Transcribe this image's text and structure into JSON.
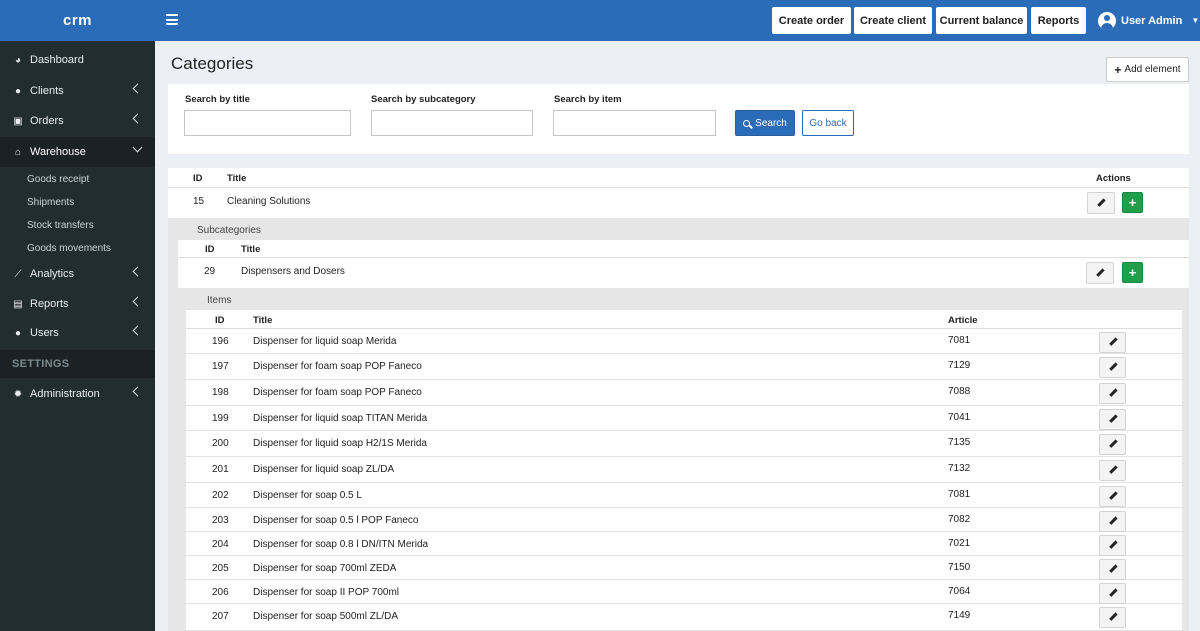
{
  "header": {
    "brand": "crm",
    "buttons": [
      "Create order",
      "Create client",
      "Current balance",
      "Reports"
    ],
    "user": "User Admin"
  },
  "sidebar": {
    "items": [
      {
        "label": "Dashboard",
        "icon": "dashboard-icon"
      },
      {
        "label": "Clients",
        "icon": "users-icon"
      },
      {
        "label": "Orders",
        "icon": "box-icon"
      },
      {
        "label": "Warehouse",
        "icon": "home-icon"
      },
      {
        "label": "Analytics",
        "icon": "chart-line-icon"
      },
      {
        "label": "Reports",
        "icon": "file-icon"
      },
      {
        "label": "Users",
        "icon": "users-icon"
      },
      {
        "label": "Administration",
        "icon": "gear-icon"
      }
    ],
    "warehouse_sub": [
      "Goods receipt",
      "Shipments",
      "Stock transfers",
      "Goods movements"
    ],
    "settings_label": "SETTINGS"
  },
  "page": {
    "title": "Categories",
    "add_label": "Add element"
  },
  "filters": {
    "title_label": "Search by title",
    "subcategory_label": "Search by subcategory",
    "item_label": "Search by item",
    "title_value": "",
    "subcategory_value": "",
    "item_value": "",
    "search_label": "Search",
    "goback_label": "Go back"
  },
  "category_table": {
    "headers": {
      "id": "ID",
      "title": "Title",
      "actions": "Actions"
    },
    "row": {
      "id": "15",
      "title": "Cleaning Solutions"
    }
  },
  "subcategories": {
    "label": "Subcategories",
    "headers": {
      "id": "ID",
      "title": "Title"
    },
    "row": {
      "id": "29",
      "title": "Dispensers and Dosers"
    }
  },
  "items": {
    "label": "Items",
    "headers": {
      "id": "ID",
      "title": "Title",
      "article": "Article"
    },
    "rows": [
      {
        "id": "196",
        "title": "Dispenser for liquid soap Merida",
        "article": "7081"
      },
      {
        "id": "197",
        "title": "Dispenser for foam soap POP Faneco",
        "article": "7129"
      },
      {
        "id": "198",
        "title": "Dispenser for foam soap POP Faneco",
        "article": "7088"
      },
      {
        "id": "199",
        "title": "Dispenser for liquid soap TITAN Merida",
        "article": "7041"
      },
      {
        "id": "200",
        "title": "Dispenser for liquid soap H2/1S Merida",
        "article": "7135"
      },
      {
        "id": "201",
        "title": "Dispenser for liquid soap ZL/DA",
        "article": "7132"
      },
      {
        "id": "202",
        "title": "Dispenser for soap 0.5 L",
        "article": "7081"
      },
      {
        "id": "203",
        "title": "Dispenser for soap 0.5 l POP Faneco",
        "article": "7082"
      },
      {
        "id": "204",
        "title": "Dispenser for soap 0.8 l DN/ITN Merida",
        "article": "7021"
      },
      {
        "id": "205",
        "title": "Dispenser for soap 700ml ZEDA",
        "article": "7150"
      },
      {
        "id": "206",
        "title": "Dispenser for soap II POP 700ml",
        "article": "7064"
      },
      {
        "id": "207",
        "title": "Dispenser for soap 500ml ZL/DA",
        "article": "7149"
      }
    ]
  },
  "colors": {
    "primary": "#2b6cb8",
    "sidebar": "#222d32",
    "success": "#1f9e4b"
  }
}
